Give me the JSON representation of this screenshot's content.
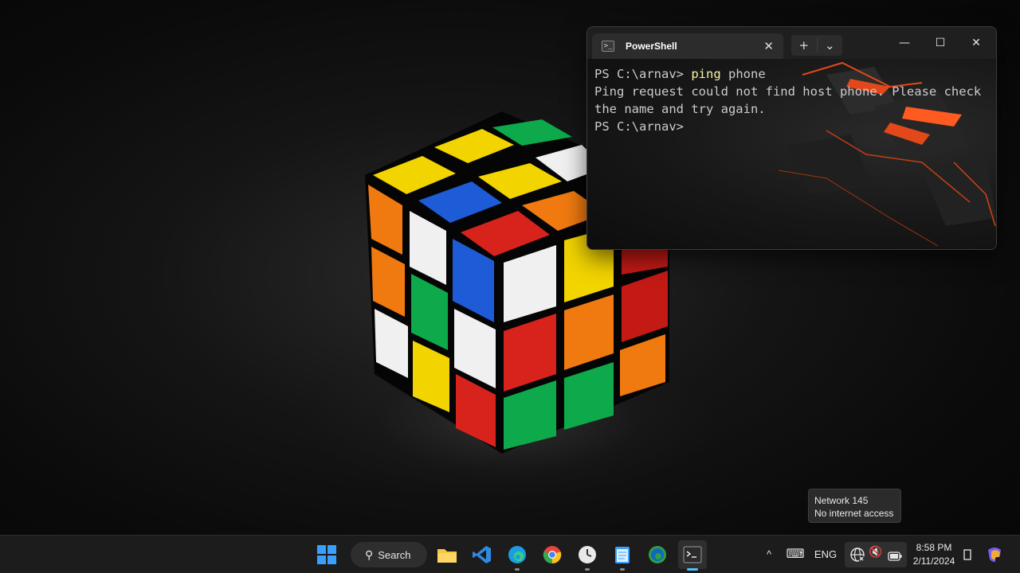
{
  "terminal": {
    "tab_title": "PowerShell",
    "tab_icon": "powershell-icon",
    "new_tab_symbol": "+",
    "dropdown_symbol": "⌄",
    "close_tab_symbol": "✕",
    "minimize_symbol": "—",
    "maximize_symbol": "☐",
    "close_symbol": "✕",
    "lines": [
      {
        "prompt": "PS C:\\arnav> ",
        "command": "ping",
        "args": " phone"
      },
      {
        "output": "Ping request could not find host phone. Please check the name and try again."
      },
      {
        "prompt": "PS C:\\arnav>"
      }
    ]
  },
  "tooltip": {
    "line1": "Network 145",
    "line2": "No internet access"
  },
  "taskbar": {
    "search_label": "Search",
    "pinned": [
      {
        "name": "windows-start-icon"
      },
      {
        "name": "file-explorer-icon"
      },
      {
        "name": "vscode-icon"
      },
      {
        "name": "edge-icon"
      },
      {
        "name": "chrome-icon"
      },
      {
        "name": "clock-app-icon"
      },
      {
        "name": "notepad-icon"
      },
      {
        "name": "edge-dev-icon"
      },
      {
        "name": "terminal-icon"
      }
    ],
    "tray": {
      "chevron": "^",
      "keyboard": "⌨",
      "language": "ENG",
      "volume": "🔇",
      "battery": "battery-icon"
    },
    "time": "8:58 PM",
    "date": "2/11/2024"
  }
}
